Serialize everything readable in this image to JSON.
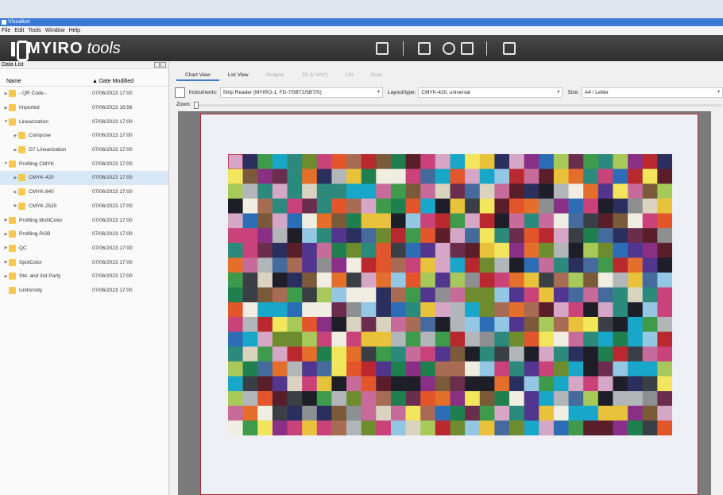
{
  "window": {
    "title": "Visualize"
  },
  "menu": [
    "File",
    "Edit",
    "Tools",
    "Window",
    "Help"
  ],
  "brand": {
    "name": "MYIRO",
    "suffix": "tools"
  },
  "data_list": {
    "title": "Data List",
    "columns": {
      "name": "Name",
      "date": "Date Modified"
    },
    "items": [
      {
        "name": "- QR Code -",
        "date": "07/06/2023 17:00",
        "indent": 0,
        "expanded": false
      },
      {
        "name": "Imported",
        "date": "07/06/2023 16:56",
        "indent": 0,
        "expanded": false
      },
      {
        "name": "Linearization",
        "date": "07/06/2023 17:00",
        "indent": 0,
        "expanded": true
      },
      {
        "name": "Compose",
        "date": "07/06/2023 17:00",
        "indent": 1,
        "expanded": false
      },
      {
        "name": "G7 Linearization",
        "date": "07/06/2023 17:00",
        "indent": 1,
        "expanded": false
      },
      {
        "name": "Profiling CMYK",
        "date": "07/06/2023 17:00",
        "indent": 0,
        "expanded": true
      },
      {
        "name": "CMYK-420",
        "date": "07/06/2023 17:00",
        "indent": 1,
        "expanded": false,
        "selected": true
      },
      {
        "name": "CMYK-840",
        "date": "07/06/2023 17:00",
        "indent": 1,
        "expanded": false
      },
      {
        "name": "CMYK-2520",
        "date": "07/06/2023 17:00",
        "indent": 1,
        "expanded": false
      },
      {
        "name": "Profiling MultiColor",
        "date": "07/06/2023 17:00",
        "indent": 0,
        "expanded": false
      },
      {
        "name": "Profiling RGB",
        "date": "07/06/2023 17:00",
        "indent": 0,
        "expanded": false
      },
      {
        "name": "QC",
        "date": "07/06/2023 17:00",
        "indent": 0,
        "expanded": false
      },
      {
        "name": "SpotColor",
        "date": "07/06/2023 17:00",
        "indent": 0,
        "expanded": false
      },
      {
        "name": "Std. and 3rd Party",
        "date": "07/06/2023 17:00",
        "indent": 0,
        "expanded": false
      },
      {
        "name": "Uniformity",
        "date": "07/06/2023 17:00",
        "indent": 0,
        "leaf": true
      }
    ]
  },
  "tabs": [
    {
      "label": "Chart View",
      "active": true
    },
    {
      "label": "List View",
      "active": false,
      "enabled": true
    },
    {
      "label": "Analyse",
      "enabled": false
    },
    {
      "label": "2D (L*a*b*)",
      "enabled": false
    },
    {
      "label": "LIN",
      "enabled": false
    },
    {
      "label": "Scan",
      "enabled": false
    }
  ],
  "controls": {
    "instruments_label": "Instruments:",
    "instruments_value": "Strip Reader (MYIRO-1, FD-7/5BT2/5BT/5)",
    "layout_label": "Layout/type:",
    "layout_value": "CMYK-420, universal",
    "size_label": "Size:",
    "size_value": "A4 / Letter",
    "zoom_label": "Zoom:"
  },
  "colors": {
    "accent": "#3a7bd5",
    "brand_bg": "#333333",
    "folder": "#f6c852",
    "page_border": "#b82232"
  },
  "chart_grid": {
    "columns": 30,
    "rows": 19
  }
}
